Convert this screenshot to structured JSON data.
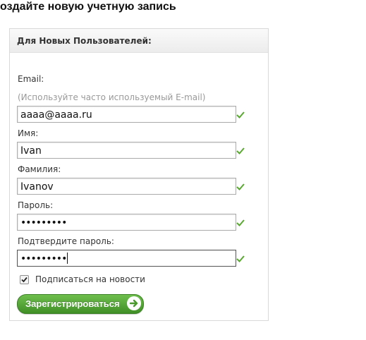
{
  "page": {
    "title": "оздайте новую учетную запись"
  },
  "panel": {
    "header": "Для Новых Пользователей:"
  },
  "form": {
    "email_label": "Email:",
    "email_hint": "(Используйте часто используемый E-mail)",
    "email_value": "aaaa@aaaa.ru",
    "first_name_label": "Имя:",
    "first_name_value": "Ivan",
    "last_name_label": "Фамилия:",
    "last_name_value": "Ivanov",
    "password_label": "Пароль:",
    "password_value": "•••••••••",
    "confirm_label": "Подтвердите пароль:",
    "confirm_value": "•••••••••",
    "newsletter_label": "Подписаться на новости",
    "newsletter_checked": true,
    "submit_label": "Зарегистрироваться"
  },
  "icons": {
    "valid": "check-icon",
    "submit_arrow": "arrow-right-circle-icon"
  },
  "colors": {
    "valid_check": "#5aa832",
    "button_top": "#6fbf4e",
    "button_bottom": "#3f8f27"
  }
}
